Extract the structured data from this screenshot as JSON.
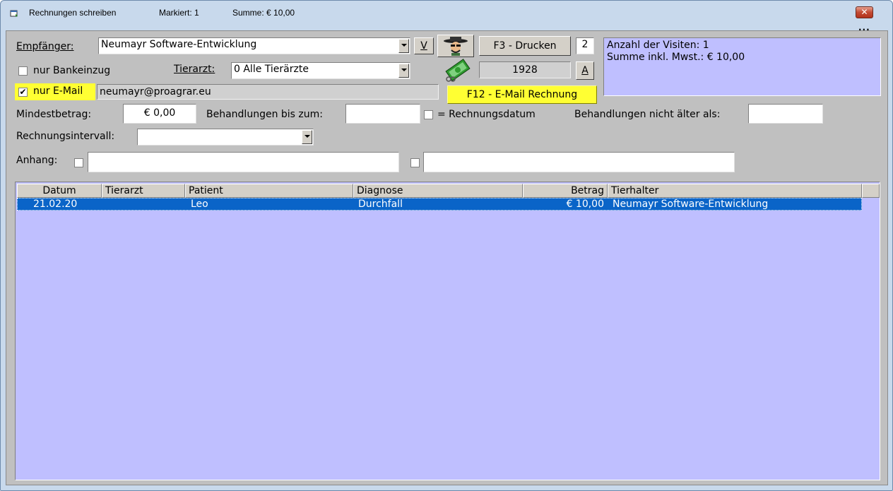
{
  "titlebar": {
    "app_title": "Rechnungen schreiben",
    "marked": "Markiert: 1",
    "sum": "Summe: € 10,00",
    "close_label": "✕",
    "more_label": "..."
  },
  "form": {
    "recipient_label": "Empfänger:",
    "recipient_value": "Neumayr Software-Entwicklung",
    "v_button": "V",
    "bank_only_label": "nur Bankeinzug",
    "bank_only_checked": false,
    "vet_label": "Tierarzt:",
    "vet_value": "0  Alle Tierärzte",
    "email_only_label": "nur E-Mail",
    "email_only_checked": true,
    "email_value": "neumayr@proagrar.eu",
    "print_button": "F3 - Drucken",
    "copies": "2",
    "number": "1928",
    "a_button": "A",
    "email_invoice_button": "F12 - E-Mail Rechnung",
    "min_amount_label": "Mindestbetrag:",
    "min_amount_value": "€ 0,00",
    "treatments_until_label": "Behandlungen bis zum:",
    "treatments_until_value": "",
    "invoice_date_label": "= Rechnungsdatum",
    "treatments_not_older_label": "Behandlungen nicht älter als:",
    "treatments_not_older_value": "",
    "interval_label": "Rechnungsintervall:",
    "interval_value": "",
    "attachment_label": "Anhang:",
    "attachment1_value": "",
    "attachment2_value": ""
  },
  "info": {
    "visits": "Anzahl der Visiten: 1",
    "total": "Summe inkl. Mwst.: € 10,00"
  },
  "grid": {
    "columns": [
      "Datum",
      "Tierarzt",
      "Patient",
      "Diagnose",
      "Betrag",
      "Tierhalter"
    ],
    "rows": [
      [
        "21.02.20",
        "",
        "Leo",
        "Durchfall",
        "€ 10,00",
        "Neumayr Software-Entwicklung"
      ]
    ]
  },
  "colors": {
    "list_background": "#bfbfff",
    "selection": "#0a64c8",
    "highlight": "#ffff33"
  },
  "icons": [
    "doctor-icon",
    "money-icon",
    "printer-window-icon"
  ]
}
